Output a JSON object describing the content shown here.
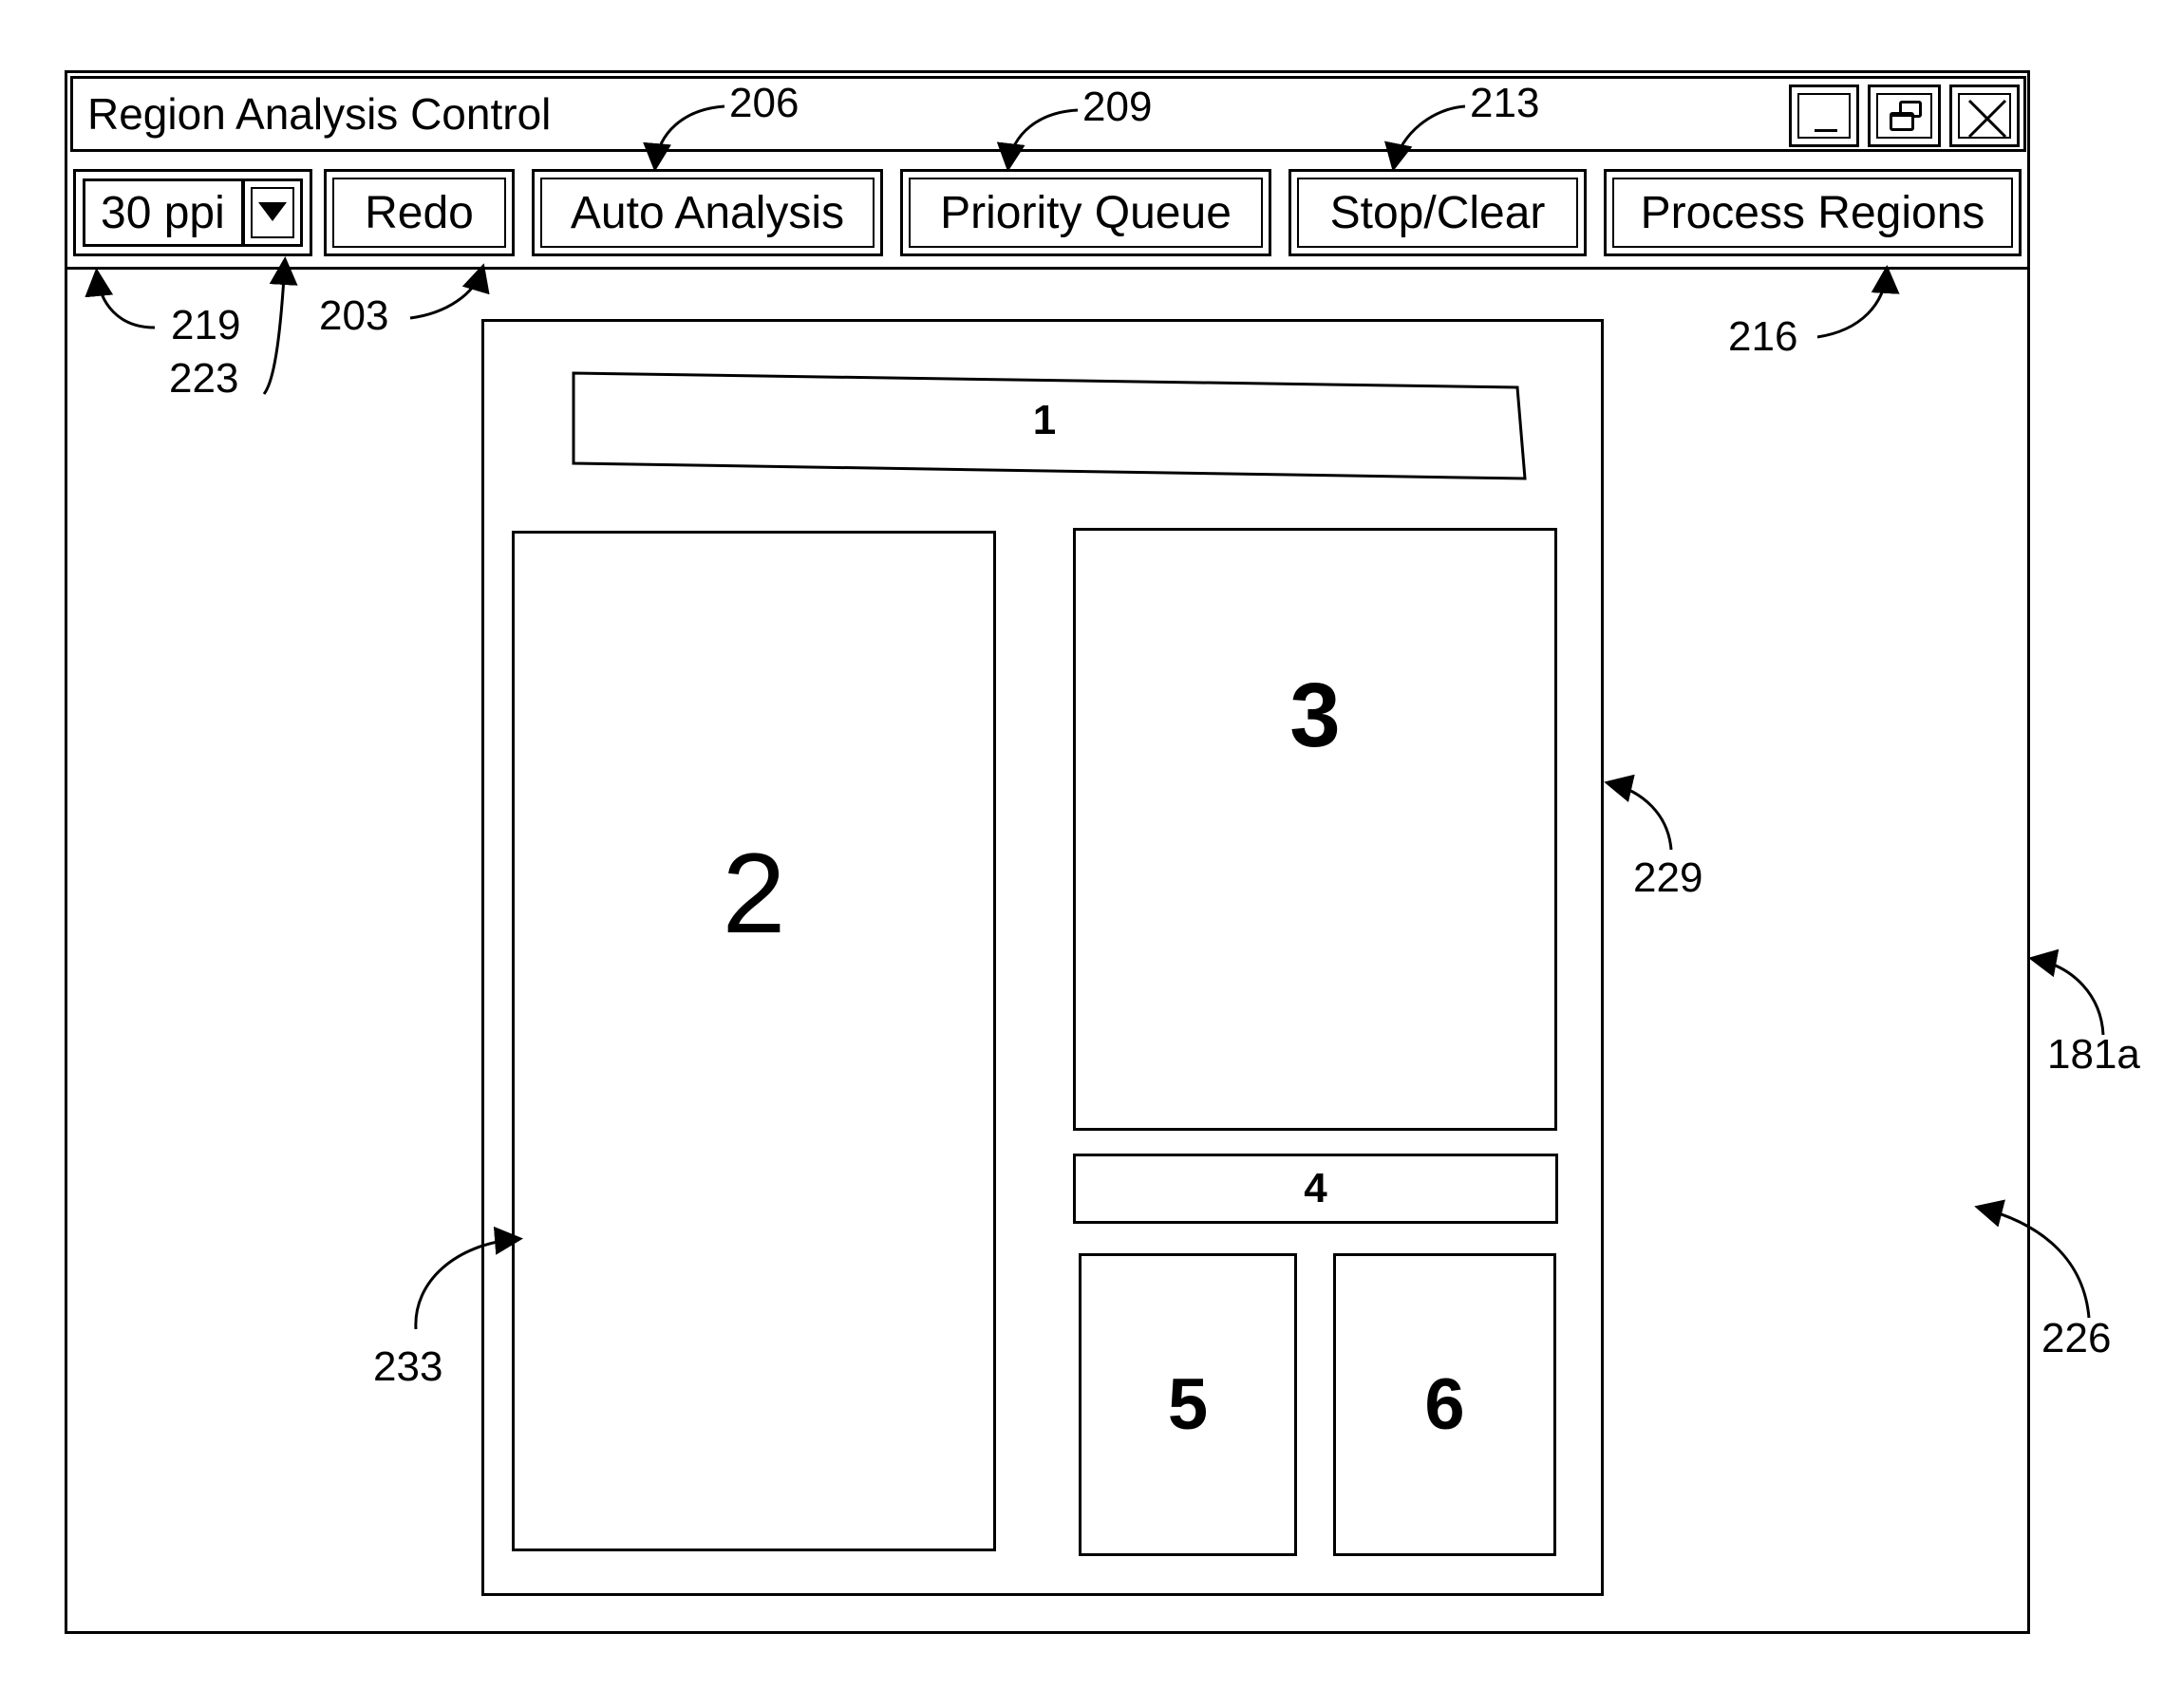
{
  "window": {
    "title": "Region Analysis Control",
    "controls": {
      "minimize_icon": "minimize-icon",
      "restore_icon": "restore-icon",
      "close_icon": "close-icon"
    }
  },
  "toolbar": {
    "resolution": {
      "value": "30 ppi",
      "dropdown_icon": "triangle-down-icon"
    },
    "buttons": [
      {
        "id": "redo",
        "label": "Redo"
      },
      {
        "id": "auto-analysis",
        "label": "Auto Analysis"
      },
      {
        "id": "priority-queue",
        "label": "Priority Queue"
      },
      {
        "id": "stop-clear",
        "label": "Stop/Clear"
      },
      {
        "id": "process-regions",
        "label": "Process Regions"
      }
    ]
  },
  "canvas": {
    "regions": [
      {
        "label": "1"
      },
      {
        "label": "2"
      },
      {
        "label": "3"
      },
      {
        "label": "4"
      },
      {
        "label": "5"
      },
      {
        "label": "6"
      }
    ]
  },
  "callouts": {
    "c203": "203",
    "c206": "206",
    "c209": "209",
    "c213": "213",
    "c216": "216",
    "c219": "219",
    "c223": "223",
    "c226": "226",
    "c229": "229",
    "c233": "233",
    "c181a": "181a"
  }
}
